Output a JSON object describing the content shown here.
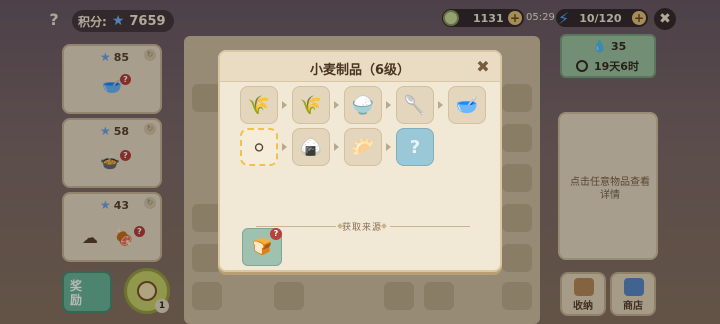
{
  "topbar": {
    "help_label": "?",
    "score_label": "积分:",
    "score_value": "7659",
    "coins": "1131",
    "timer": "05:29",
    "energy": "10/120",
    "close_label": "✖"
  },
  "orders": [
    {
      "points": "85"
    },
    {
      "points": "58"
    },
    {
      "points": "43"
    }
  ],
  "left_buttons": {
    "reward_label": "奖\n励",
    "clock_count": "1"
  },
  "right_panel": {
    "energy_value": "35",
    "cooldown": "19天6时",
    "detail_hint": "点击任意物品查看详情",
    "storage_label": "收纳",
    "shop_label": "商店"
  },
  "modal": {
    "title": "小麦制品（6级）",
    "source_header": "获取来源",
    "chain": [
      {
        "icon": "wheat-icon",
        "glyph": "🌾"
      },
      {
        "icon": "wheat-bundle-icon",
        "glyph": "🌾"
      },
      {
        "icon": "flour-sack-icon",
        "glyph": "🍚"
      },
      {
        "icon": "flour-scoop-icon",
        "glyph": "🥄"
      },
      {
        "icon": "flour-bowl-icon",
        "glyph": "🥣"
      },
      {
        "icon": "dough-icon",
        "glyph": "⚪"
      },
      {
        "icon": "steamed-bun-icon",
        "glyph": "🍙"
      },
      {
        "icon": "bun-plate-icon",
        "glyph": "🥟"
      },
      {
        "icon": "locked-rabbit-icon",
        "glyph": "?"
      }
    ],
    "source_glyph": "🍞"
  }
}
